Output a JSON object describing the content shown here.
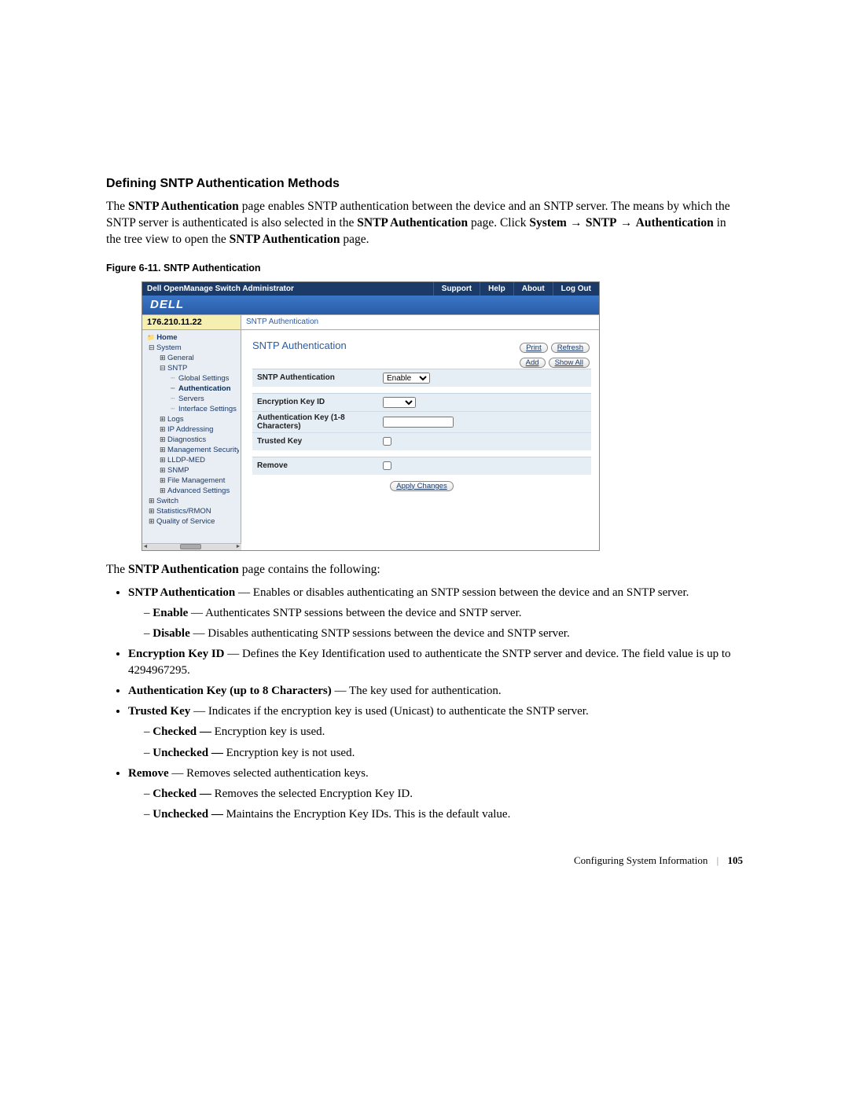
{
  "doc": {
    "heading": "Defining SNTP Authentication Methods",
    "p1_a": "The ",
    "p1_b": "SNTP Authentication",
    "p1_c": " page enables SNTP authentication between the device and an SNTP server. The means by which the SNTP server is authenticated is also selected in the ",
    "p1_d": "SNTP Authentication",
    "p1_e": " page. Click ",
    "p1_f": "System",
    "p1_arrow1": " → ",
    "p1_g": "SNTP",
    "p1_arrow2": " → ",
    "p1_h": "Authentication",
    "p1_i": " in the tree view to open the ",
    "p1_j": "SNTP Authentication",
    "p1_k": " page.",
    "fig_caption": "Figure 6-11.    SNTP Authentication",
    "p2_a": "The ",
    "p2_b": "SNTP Authentication",
    "p2_c": " page contains the following:",
    "b1_a": "SNTP Authentication",
    "b1_b": " — Enables or disables authenticating an SNTP session between the device and an SNTP server.",
    "b1_d1_a": "Enable",
    "b1_d1_b": " — Authenticates SNTP sessions between the device and SNTP server.",
    "b1_d2_a": "Disable",
    "b1_d2_b": " — Disables authenticating SNTP sessions between the device and SNTP server.",
    "b2_a": "Encryption Key ID",
    "b2_b": " — Defines the Key Identification used to authenticate the SNTP server and device. The field value is up to 4294967295.",
    "b3_a": "Authentication Key (up to 8 Characters)",
    "b3_b": " — The key used for authentication.",
    "b4_a": "Trusted Key",
    "b4_b": " — Indicates if the encryption key is used (Unicast) to authenticate the SNTP server.",
    "b4_d1_a": "Checked — ",
    "b4_d1_b": "Encryption key is used.",
    "b4_d2_a": "Unchecked — ",
    "b4_d2_b": "Encryption key is not used.",
    "b5_a": "Remove",
    "b5_b": " — Removes selected authentication keys.",
    "b5_d1_a": "Checked — ",
    "b5_d1_b": "Removes the selected Encryption Key ID.",
    "b5_d2_a": "Unchecked — ",
    "b5_d2_b": "Maintains the Encryption Key IDs. This is the default value.",
    "footer_section": "Configuring System Information",
    "footer_page": "105"
  },
  "mock": {
    "app_title": "Dell OpenManage Switch Administrator",
    "nav": {
      "support": "Support",
      "help": "Help",
      "about": "About",
      "logout": "Log Out"
    },
    "brand": "DELL",
    "ip": "176.210.11.22",
    "crumb": "SNTP Authentication",
    "tree": {
      "home": "Home",
      "system": "System",
      "general": "General",
      "sntp": "SNTP",
      "global": "Global Settings",
      "auth": "Authentication",
      "servers": "Servers",
      "iface": "Interface Settings",
      "logs": "Logs",
      "ipaddr": "IP Addressing",
      "diag": "Diagnostics",
      "mgmtsec": "Management Security",
      "lldp": "LLDP-MED",
      "snmp": "SNMP",
      "filemgmt": "File Management",
      "advset": "Advanced Settings",
      "switch": "Switch",
      "stats": "Statistics/RMON",
      "qos": "Quality of Service"
    },
    "content": {
      "title": "SNTP Authentication",
      "print": "Print",
      "refresh": "Refresh",
      "add": "Add",
      "showall": "Show All",
      "row_sntp": "SNTP Authentication",
      "row_sntp_val": "Enable",
      "row_enckey": "Encryption Key ID",
      "row_authkey": "Authentication Key (1-8 Characters)",
      "row_trusted": "Trusted Key",
      "row_remove": "Remove",
      "apply": "Apply Changes"
    }
  }
}
